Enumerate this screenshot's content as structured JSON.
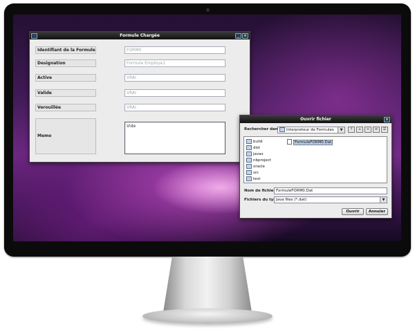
{
  "formula_window": {
    "title": "Formule Chargée",
    "fields": [
      {
        "label": "Identifiant de la Formule",
        "value": "FORM0"
      },
      {
        "label": "Designation",
        "value": "Formule Employe1"
      },
      {
        "label": "Active",
        "value": "VRAI"
      },
      {
        "label": "Valide",
        "value": "VRAI"
      },
      {
        "label": "Verouillée",
        "value": "VRAI"
      }
    ],
    "memo": {
      "label": "Memo",
      "value": "Vide"
    }
  },
  "open_dialog": {
    "title": "Ouvrir fichier",
    "look_in_label": "Rechercher dans :",
    "look_in_value": "Interpreteur de Formules",
    "folders": [
      "build",
      "dist",
      "javax",
      "nbproject",
      "oracle",
      "src",
      "test"
    ],
    "selected_file": "FormuleFORM0.Dat",
    "filename_label": "Nom de fichier :",
    "filename_value": "FormuleFORM0.Dat",
    "filetype_label": "Fichiers du type :",
    "filetype_value": "Java files (*.dat)",
    "open_button": "Ouvrir",
    "cancel_button": "Annuler"
  },
  "icons": {
    "minimize": "minimize-icon",
    "close": "close-icon",
    "folder": "folder-icon",
    "dropdown": "chevron-down-icon"
  }
}
